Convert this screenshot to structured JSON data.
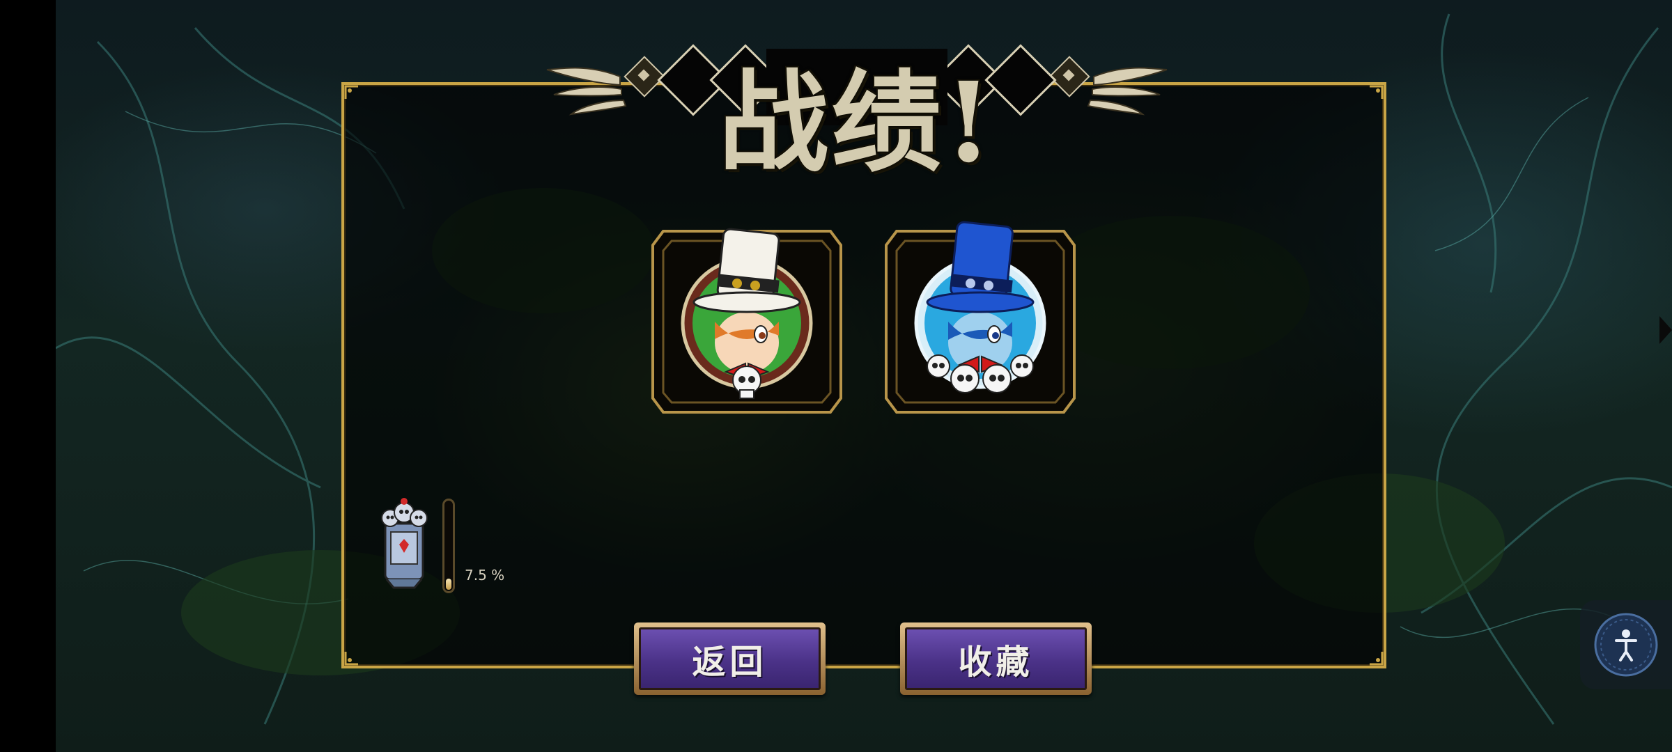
{
  "title": "战绩!",
  "characters": [
    {
      "name": "peacock-white-hat",
      "theme": "green",
      "skulls": 1
    },
    {
      "name": "peacock-blue-hat",
      "theme": "blue",
      "skulls": 4
    }
  ],
  "progress": {
    "value": 7.5,
    "label": "7.5 %"
  },
  "buttons": {
    "back_label": "返回",
    "collect_label": "收藏"
  },
  "colors": {
    "frame_gold": "#c9a546",
    "button_purple": "#4b3288",
    "accent_blue": "#1f6fd9",
    "accent_green": "#3aa63a"
  },
  "icons": [
    "trophy-icon",
    "accessibility-icon"
  ]
}
